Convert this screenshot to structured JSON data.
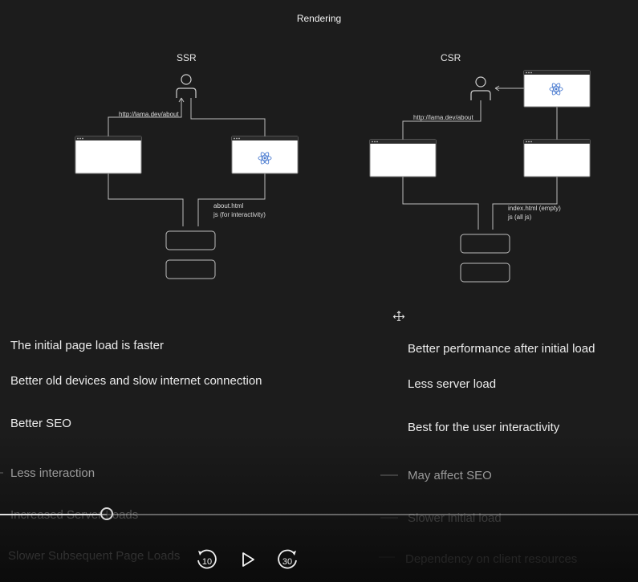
{
  "title": "Rendering",
  "ssr": {
    "label": "SSR",
    "request": "http://lama.dev/about",
    "response_line1": "about.html",
    "response_line2": "js (for interactivity)"
  },
  "csr": {
    "label": "CSR",
    "request": "http://lama.dev/about",
    "response_line1": "index.html (empty)",
    "response_line2": "js (all js)"
  },
  "pros_left": [
    "The initial page load is faster",
    "Better old devices and slow internet connection",
    "Better SEO"
  ],
  "cons_left": [
    "Less interaction",
    "Increased Server Loads",
    "Slower Subsequent Page Loads"
  ],
  "pros_right": [
    "Better performance after initial load",
    "Less server load",
    "Best for the user interactivity"
  ],
  "cons_right": [
    "May affect SEO",
    "Slower initial load",
    "Dependency on client resources"
  ],
  "player": {
    "rewind_seconds": "10",
    "forward_seconds": "30",
    "progress": 0.167
  },
  "colors": {
    "background": "#1c1c1c",
    "line": "#bdbdbd",
    "box": "#ffffff",
    "react_logo": "#4a7bd0"
  },
  "icons": [
    "user-icon",
    "react-logo-icon",
    "move-cursor-icon",
    "plus-icon",
    "minus-icon",
    "rewind-10-icon",
    "play-icon",
    "forward-30-icon"
  ]
}
